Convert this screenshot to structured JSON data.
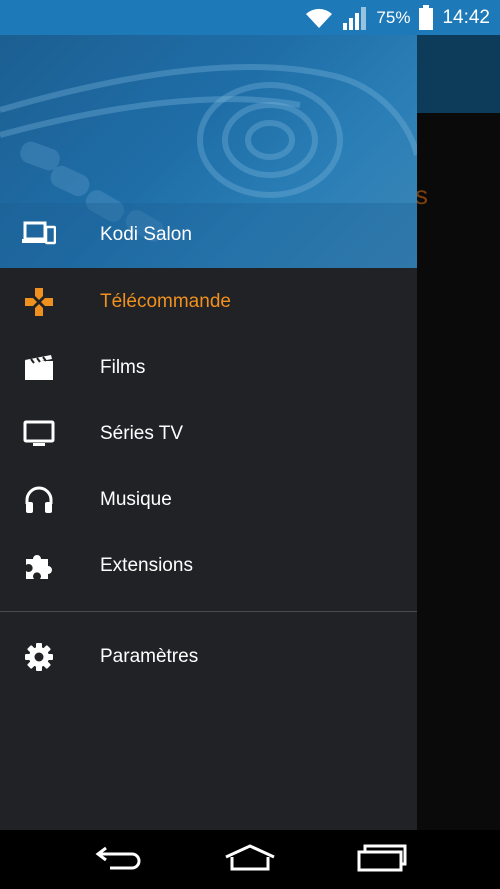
{
  "status_bar": {
    "battery_percent": "75%",
    "time": "14:42",
    "icons": [
      "wifi-icon",
      "signal-icon",
      "battery-icon"
    ]
  },
  "background_app": {
    "peek_text": "s"
  },
  "drawer": {
    "host": {
      "label": "Kodi Salon",
      "icon": "devices-icon"
    },
    "items": [
      {
        "label": "Télécommande",
        "icon": "gamepad-icon",
        "active": true
      },
      {
        "label": "Films",
        "icon": "movie-clapper-icon",
        "active": false
      },
      {
        "label": "Séries TV",
        "icon": "tv-icon",
        "active": false
      },
      {
        "label": "Musique",
        "icon": "headphones-icon",
        "active": false
      },
      {
        "label": "Extensions",
        "icon": "puzzle-icon",
        "active": false
      }
    ],
    "settings": {
      "label": "Paramètres",
      "icon": "gear-icon"
    }
  },
  "colors": {
    "status_bar": "#1e79b8",
    "drawer_bg": "#212225",
    "accent": "#f0901e",
    "text": "#ffffff"
  },
  "navigation_bar": {
    "buttons": [
      "back-icon",
      "home-icon",
      "recent-apps-icon"
    ]
  }
}
